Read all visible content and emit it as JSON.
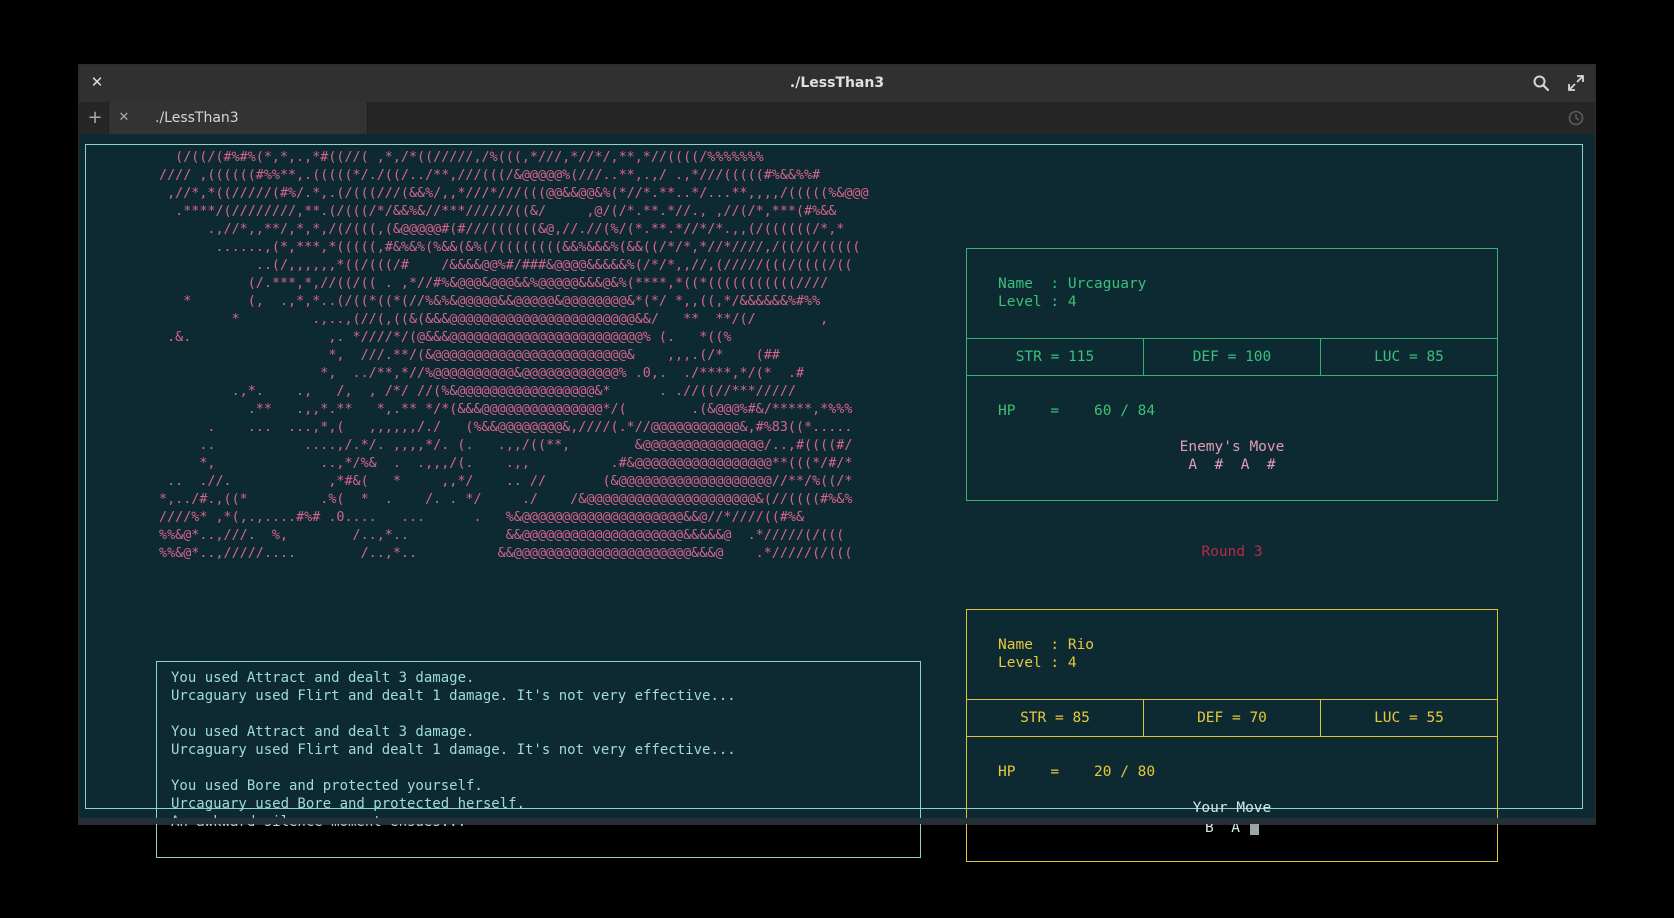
{
  "window": {
    "title": "./LessThan3",
    "tab_label": "./LessThan3",
    "close_glyph": "✕",
    "add_tab_glyph": "+",
    "tab_close_glyph": "✕"
  },
  "ascii_art": "   (/((/(#%#%(*,*,.,*#((//( ,*,/*((/////,/%(((,*///,*//*/,**,*//((((/%%%%%%%\n //// ,((((((#%%**,.(((((*/./((/../**,///(((/&@@@@@%(///..**,.,/ .,*///(((((#%&&%%#\n  ,//*,*((/////(#%/.*,.(/(((///(&&%/,,*///*///(((@@&&@@&%(*//*.**..*/...**,,,,/(((((%&@@@\n   .****/(////////,**.(/(((/*/&&%&//***//////((&/     ,@/(/*.**.*//., ,//(/*,***(#%&&\n       .,//*,,**/,*,*,/(/(((,(&@@@@@#(#///((((((&@,//.//(%/(*.**.*//*/*.,,(/((((((/*,*\n        ......,(*,***,*(((((,#&%&%(%&&(&%(/((((((((&&%&&&%(&&((/*/*,*//*////,/((/(/(((((\n             ..(/,,,,,,*((/(((/#    /&&&&@@%#/###&@@@@&&&&&%(/*/*,,//,(/////(((/((((/((\n            (/.***,*,//((/(( . ,*//#%&@@@&@@@&&%@@@@@&&&@&%(****,*((*(((((((((((////\n    *       (,  .,*,*..(/((*((*(//%&%&@@@@@&&@@@@@&@@@@@@@@&*(*/ *,,((,*/&&&&&&%#%%\n          *         .,..,(//(,((&(&&&@@@@@@@@@@@@@@@@@@@@@@@&&/   **  **/(/        ,\n  .&.                 ,. *////*/(@&&&@@@@@@@@@@@@@@@@@@@@@@@@% (.   *((%\n                      *,  ///.**/(&@@@@@@@@@@@@@@@@@@@@@@@@&    ,,,.(/*    (##\n                     *,  ../**,*//%@@@@@@@@@@&@@@@@@@@@@@@% .0,.  ./****,*/(*  .#\n          .,*.    .,   /,  , /*/ //(%&@@@@@@@@@@@@@@@@@&*      . .//((//***/////\n            .**   .,,*.**   *,.** */*(&&&@@@@@@@@@@@@@@@*/(        .(&@@@%#&/*****,*%%%\n       .    ...  ...,*,(   ,,,,,,/./   (%&&@@@@@@@@&,////(.*//@@@@@@@@@@@&,#%83((*.....\n      ..           ....,/.*/. ,,,,*/. (.   .,,/((**,        &@@@@@@@@@@@@@@@/..,#((((#/\n      *,             ..,*/%&  .  .,,,/(.    .,,          .#&@@@@@@@@@@@@@@@@@**(((*/#/*\n  ..  .//.            ,*#&(   *     ,,*/    .. //       (&@@@@@@@@@@@@@@@@@@@//**/%((/*\n *,../#.,((*         .%(  *  .    /. . */     ./    /&@@@@@@@@@@@@@@@@@@@@@&(//((((#%&%\n ////%* ,*(,.,....#%# .0....   ...      .   %&@@@@@@@@@@@@@@@@@@@@&&@//*////((#%&\n %%&@*..,///.  %,        /..,*..            &&@@@@@@@@@@@@@@@@@@@@&&&&&@  .*/////(/(((\n %%&@*..,/////....        /..,*..          &&@@@@@@@@@@@@@@@@@@@@@@&&&@    .*/////(/(((",
  "battle_log": [
    "You used Attract and dealt 3 damage.",
    "Urcaguary used Flirt and dealt 1 damage. It's not very effective...",
    "",
    "You used Attract and dealt 3 damage.",
    "Urcaguary used Flirt and dealt 1 damage. It's not very effective...",
    "",
    "You used Bore and protected yourself.",
    "Urcaguary used Bore and protected herself.",
    "An awkward silence moment ensues..."
  ],
  "enemy": {
    "name_line": "Name  : Urcaguary",
    "level_line": "Level : 4",
    "str": "STR = 115",
    "def": "DEF = 100",
    "luc": "LUC = 85",
    "hp_line": "HP    =    60 / 84",
    "move_title": "Enemy's Move",
    "move_seq": "A  #  A  #",
    "color": "#3cc078"
  },
  "round": {
    "label": "Round 3",
    "color": "#b82b45"
  },
  "player": {
    "name_line": "Name  : Rio",
    "level_line": "Level : 4",
    "str": "STR = 85",
    "def": "DEF = 70",
    "luc": "LUC = 55",
    "hp_line": "HP    =    20 / 80",
    "move_title": "Your Move",
    "move_seq": "B  A",
    "color": "#e8c83c"
  },
  "icons": {
    "close": "close-icon",
    "search": "search-icon",
    "maximize": "maximize-icon",
    "add_tab": "plus-icon",
    "history": "history-icon"
  }
}
